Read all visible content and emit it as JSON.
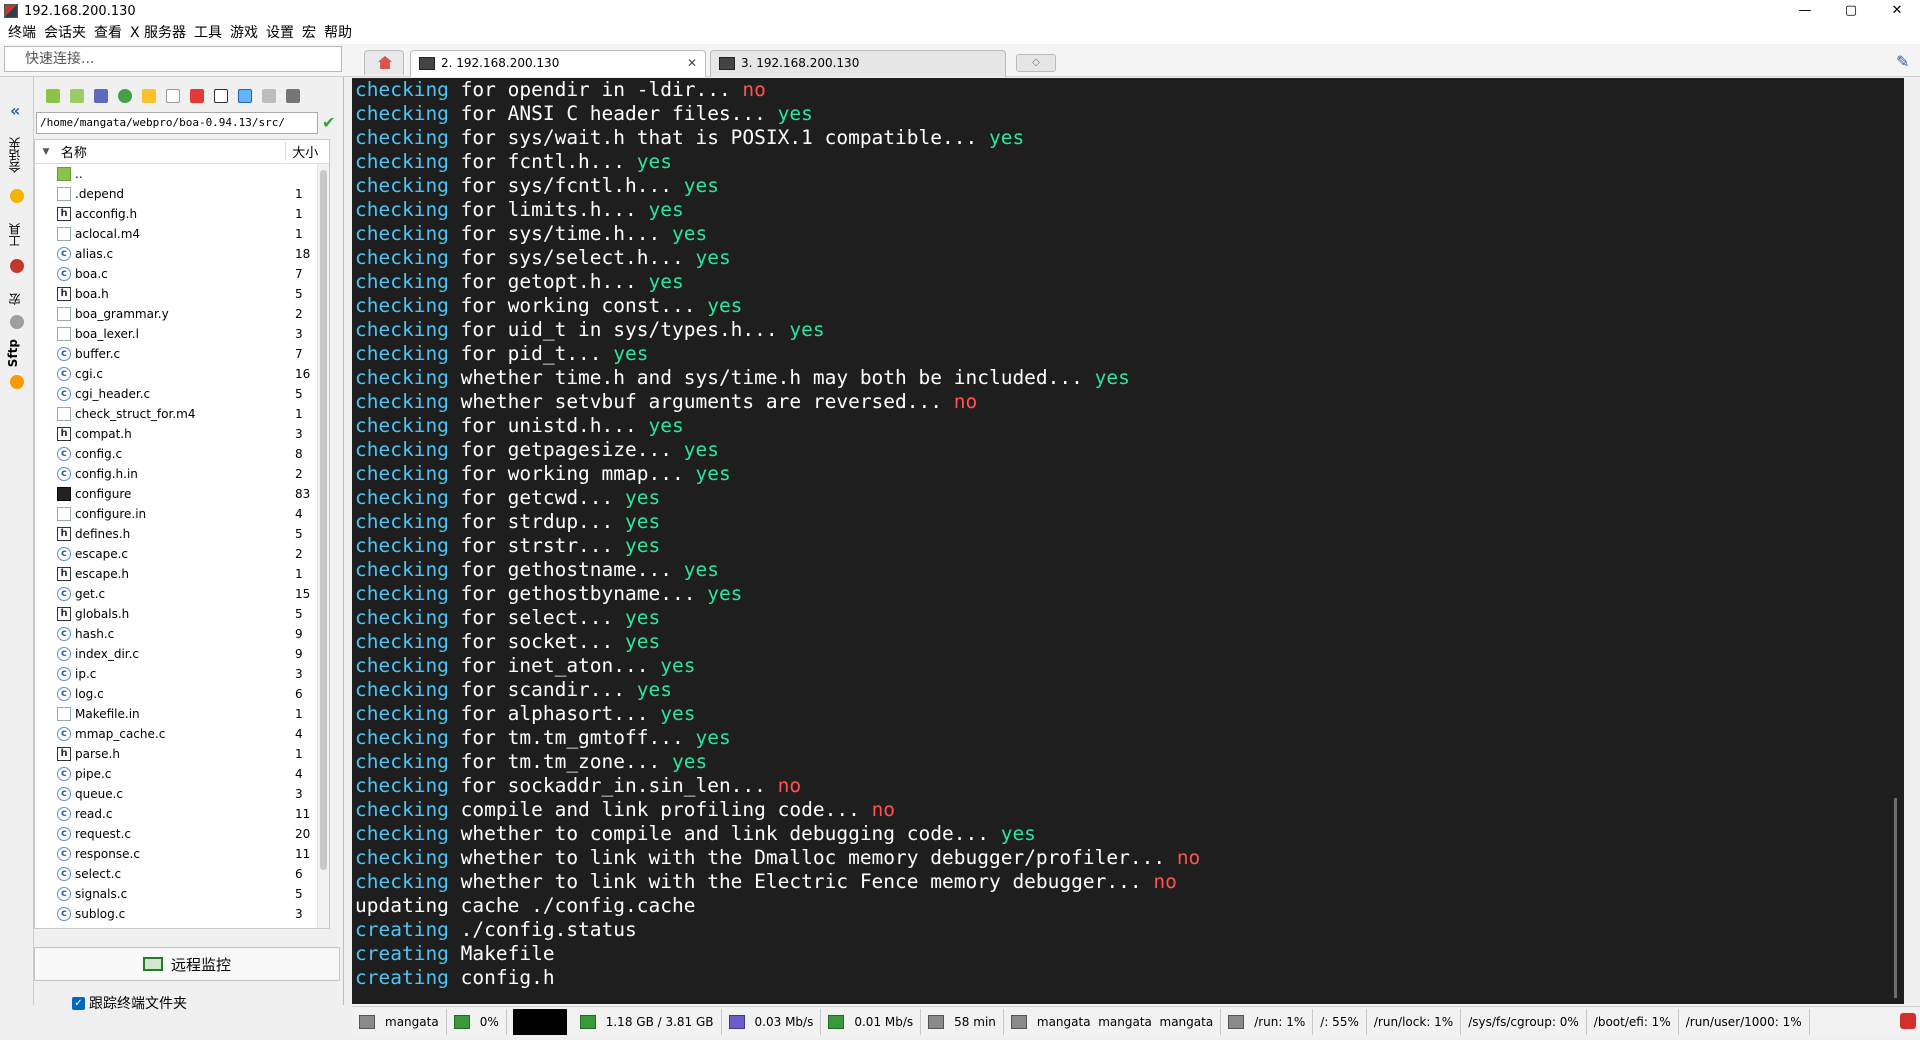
{
  "window": {
    "title": "192.168.200.130",
    "controls": [
      "—",
      "▢",
      "✕"
    ]
  },
  "menu": [
    "终端",
    "会话夹",
    "查看",
    "X 服务器",
    "工具",
    "游戏",
    "设置",
    "宏",
    "帮助"
  ],
  "quick_connect": {
    "placeholder": "快速连接..."
  },
  "tabs": [
    {
      "label": "2. 192.168.200.130",
      "active": true,
      "close": "✕"
    },
    {
      "label": "3. 192.168.200.130",
      "active": false
    }
  ],
  "tab_add_label": "◇",
  "left_tabs": [
    "会话夹",
    "工具",
    "宏",
    "Sftp"
  ],
  "sftp": {
    "path": "/home/mangata/webpro/boa-0.94.13/src/",
    "columns": {
      "name": "名称",
      "size": "大小"
    },
    "files": [
      {
        "name": "..",
        "size": "",
        "type": "dir"
      },
      {
        "name": ".depend",
        "size": "1",
        "type": "file"
      },
      {
        "name": "acconfig.h",
        "size": "1",
        "type": "h"
      },
      {
        "name": "aclocal.m4",
        "size": "1",
        "type": "file"
      },
      {
        "name": "alias.c",
        "size": "18",
        "type": "c"
      },
      {
        "name": "boa.c",
        "size": "7",
        "type": "c"
      },
      {
        "name": "boa.h",
        "size": "5",
        "type": "h"
      },
      {
        "name": "boa_grammar.y",
        "size": "2",
        "type": "file"
      },
      {
        "name": "boa_lexer.l",
        "size": "3",
        "type": "file"
      },
      {
        "name": "buffer.c",
        "size": "7",
        "type": "c"
      },
      {
        "name": "cgi.c",
        "size": "16",
        "type": "c"
      },
      {
        "name": "cgi_header.c",
        "size": "5",
        "type": "c"
      },
      {
        "name": "check_struct_for.m4",
        "size": "1",
        "type": "file"
      },
      {
        "name": "compat.h",
        "size": "3",
        "type": "h"
      },
      {
        "name": "config.c",
        "size": "8",
        "type": "c"
      },
      {
        "name": "config.h.in",
        "size": "2",
        "type": "c"
      },
      {
        "name": "configure",
        "size": "83",
        "type": "exe"
      },
      {
        "name": "configure.in",
        "size": "4",
        "type": "file"
      },
      {
        "name": "defines.h",
        "size": "5",
        "type": "h"
      },
      {
        "name": "escape.c",
        "size": "2",
        "type": "c"
      },
      {
        "name": "escape.h",
        "size": "1",
        "type": "h"
      },
      {
        "name": "get.c",
        "size": "15",
        "type": "c"
      },
      {
        "name": "globals.h",
        "size": "5",
        "type": "h"
      },
      {
        "name": "hash.c",
        "size": "9",
        "type": "c"
      },
      {
        "name": "index_dir.c",
        "size": "9",
        "type": "c"
      },
      {
        "name": "ip.c",
        "size": "3",
        "type": "c"
      },
      {
        "name": "log.c",
        "size": "6",
        "type": "c"
      },
      {
        "name": "Makefile.in",
        "size": "1",
        "type": "file"
      },
      {
        "name": "mmap_cache.c",
        "size": "4",
        "type": "c"
      },
      {
        "name": "parse.h",
        "size": "1",
        "type": "h"
      },
      {
        "name": "pipe.c",
        "size": "4",
        "type": "c"
      },
      {
        "name": "queue.c",
        "size": "3",
        "type": "c"
      },
      {
        "name": "read.c",
        "size": "11",
        "type": "c"
      },
      {
        "name": "request.c",
        "size": "20",
        "type": "c"
      },
      {
        "name": "response.c",
        "size": "11",
        "type": "c"
      },
      {
        "name": "select.c",
        "size": "6",
        "type": "c"
      },
      {
        "name": "signals.c",
        "size": "5",
        "type": "c"
      },
      {
        "name": "sublog.c",
        "size": "3",
        "type": "c"
      }
    ],
    "monitor_label": "远程监控",
    "follow_label": "跟踪终端文件夹"
  },
  "terminal": {
    "colors": {
      "keyword": "#4fc3f7",
      "yes": "#2ee59d",
      "no": "#ff5252",
      "text": "#ffffff",
      "bg": "#1e1e1e"
    },
    "lines": [
      {
        "k": "checking",
        "t": " for opendir in -ldir... ",
        "r": "no"
      },
      {
        "k": "checking",
        "t": " for ANSI C header files... ",
        "r": "yes"
      },
      {
        "k": "checking",
        "t": " for sys/wait.h that is POSIX.1 compatible... ",
        "r": "yes"
      },
      {
        "k": "checking",
        "t": " for fcntl.h... ",
        "r": "yes"
      },
      {
        "k": "checking",
        "t": " for sys/fcntl.h... ",
        "r": "yes"
      },
      {
        "k": "checking",
        "t": " for limits.h... ",
        "r": "yes"
      },
      {
        "k": "checking",
        "t": " for sys/time.h... ",
        "r": "yes"
      },
      {
        "k": "checking",
        "t": " for sys/select.h... ",
        "r": "yes"
      },
      {
        "k": "checking",
        "t": " for getopt.h... ",
        "r": "yes"
      },
      {
        "k": "checking",
        "t": " for working const... ",
        "r": "yes"
      },
      {
        "k": "checking",
        "t": " for uid_t in sys/types.h... ",
        "r": "yes"
      },
      {
        "k": "checking",
        "t": " for pid_t... ",
        "r": "yes"
      },
      {
        "k": "checking",
        "t": " whether time.h and sys/time.h may both be included... ",
        "r": "yes"
      },
      {
        "k": "checking",
        "t": " whether setvbuf arguments are reversed... ",
        "r": "no"
      },
      {
        "k": "checking",
        "t": " for unistd.h... ",
        "r": "yes"
      },
      {
        "k": "checking",
        "t": " for getpagesize... ",
        "r": "yes"
      },
      {
        "k": "checking",
        "t": " for working mmap... ",
        "r": "yes"
      },
      {
        "k": "checking",
        "t": " for getcwd... ",
        "r": "yes"
      },
      {
        "k": "checking",
        "t": " for strdup... ",
        "r": "yes"
      },
      {
        "k": "checking",
        "t": " for strstr... ",
        "r": "yes"
      },
      {
        "k": "checking",
        "t": " for gethostname... ",
        "r": "yes"
      },
      {
        "k": "checking",
        "t": " for gethostbyname... ",
        "r": "yes"
      },
      {
        "k": "checking",
        "t": " for select... ",
        "r": "yes"
      },
      {
        "k": "checking",
        "t": " for socket... ",
        "r": "yes"
      },
      {
        "k": "checking",
        "t": " for inet_aton... ",
        "r": "yes"
      },
      {
        "k": "checking",
        "t": " for scandir... ",
        "r": "yes"
      },
      {
        "k": "checking",
        "t": " for alphasort... ",
        "r": "yes"
      },
      {
        "k": "checking",
        "t": " for tm.tm_gmtoff... ",
        "r": "yes"
      },
      {
        "k": "checking",
        "t": " for tm.tm_zone... ",
        "r": "yes"
      },
      {
        "k": "checking",
        "t": " for sockaddr_in.sin_len... ",
        "r": "no"
      },
      {
        "k": "checking",
        "t": " compile and link profiling code... ",
        "r": "no"
      },
      {
        "k": "checking",
        "t": " whether to compile and link debugging code... ",
        "r": "yes"
      },
      {
        "k": "checking",
        "t": " whether to link with the Dmalloc memory debugger/profiler... ",
        "r": "no"
      },
      {
        "k": "checking",
        "t": " whether to link with the Electric Fence memory debugger... ",
        "r": "no"
      },
      {
        "k": "",
        "t": "updating cache ./config.cache",
        "r": ""
      },
      {
        "k": "creating",
        "t": " ./config.status",
        "r": ""
      },
      {
        "k": "creating",
        "t": " Makefile",
        "r": ""
      },
      {
        "k": "creating",
        "t": " config.h",
        "r": ""
      }
    ]
  },
  "statusbar": {
    "user": "mangata",
    "cpu": "0%",
    "memory": "1.18 GB / 3.81 GB",
    "upload": "0.03 Mb/s",
    "download": "0.01 Mb/s",
    "uptime": "58 min",
    "users": "mangata  mangata  mangata",
    "disks": [
      "/run: 1%",
      "/: 55%",
      "/run/lock: 1%",
      "/sys/fs/cgroup: 0%",
      "/boot/efi: 1%",
      "/run/user/1000: 1%"
    ]
  }
}
